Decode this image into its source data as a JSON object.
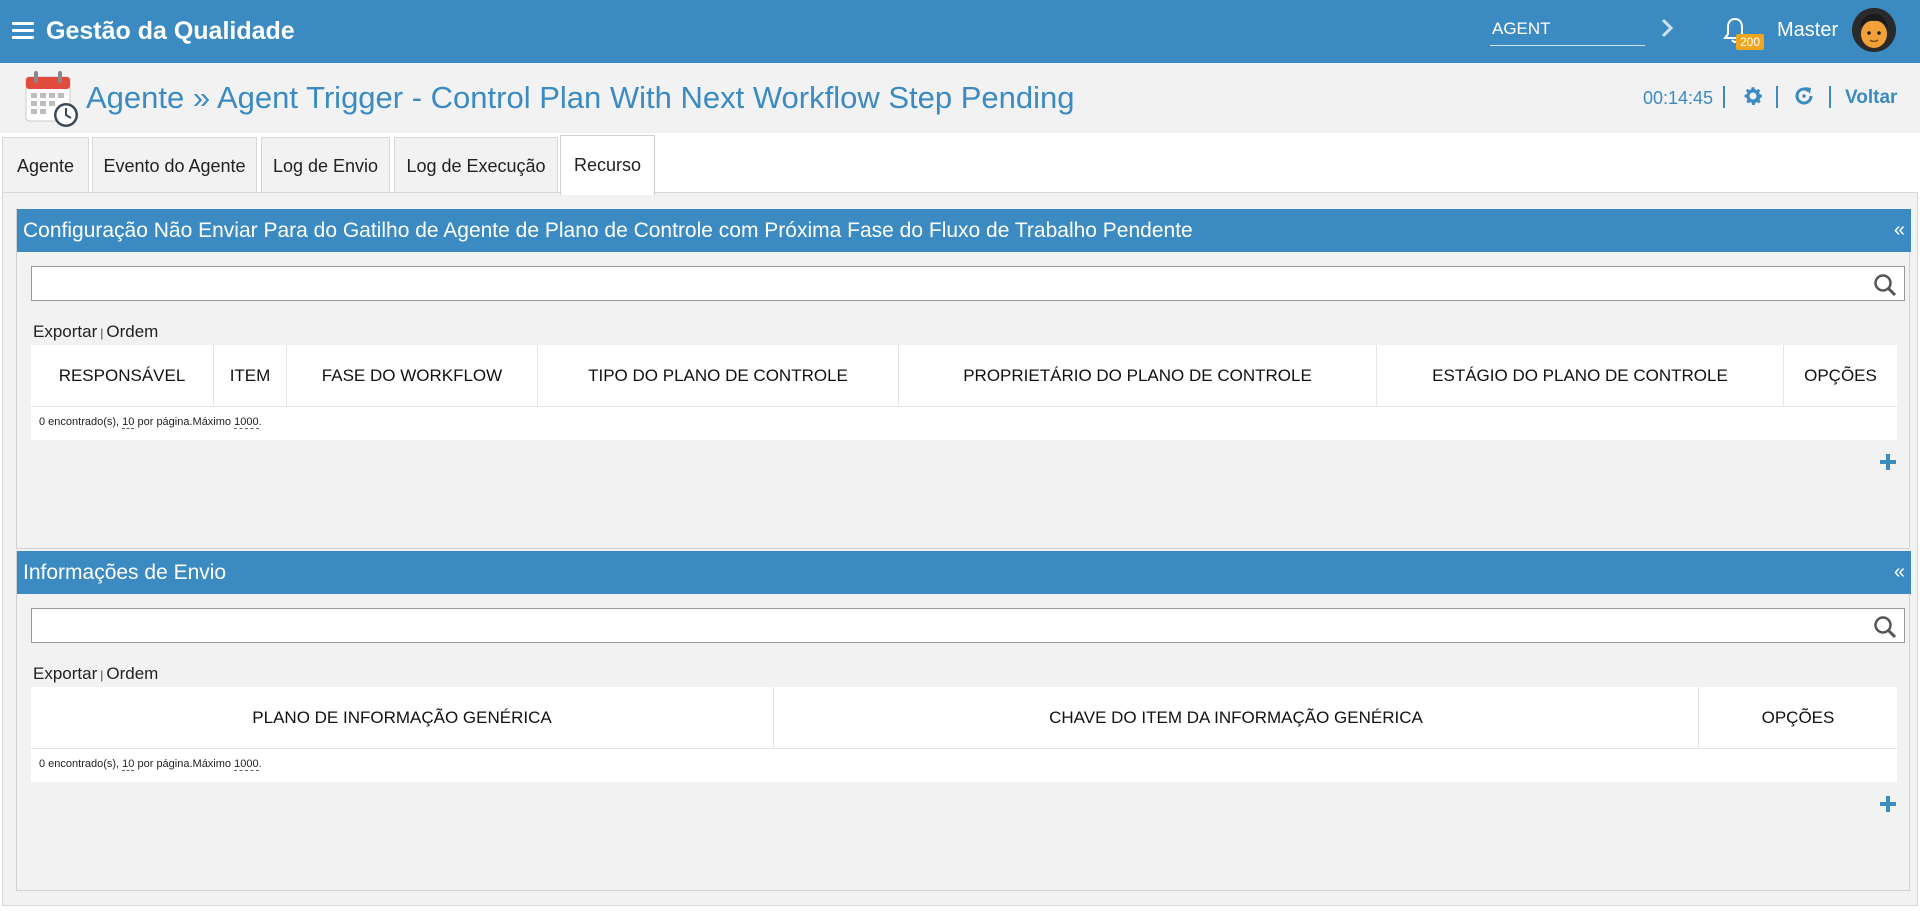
{
  "topbar": {
    "title": "Gestão da Qualidade",
    "agent_value": "AGENT",
    "notification_count": "200",
    "user_name": "Master"
  },
  "header": {
    "title": "Agente » Agent Trigger - Control Plan With Next Workflow Step Pending",
    "timer": "00:14:45",
    "back_label": "Voltar"
  },
  "tabs": [
    {
      "label": "Agente"
    },
    {
      "label": "Evento do Agente"
    },
    {
      "label": "Log de Envio"
    },
    {
      "label": "Log de Execução"
    },
    {
      "label": "Recurso"
    }
  ],
  "active_tab": "Recurso",
  "sections": [
    {
      "title": "Configuração Não Enviar Para do Gatilho de Agente de Plano de Controle com Próxima Fase do Fluxo de Trabalho Pendente",
      "collapse": "«",
      "search_value": "",
      "export_label": "Exportar",
      "order_label": "Ordem",
      "columns": [
        "RESPONSÁVEL",
        "ITEM",
        "FASE DO WORKFLOW",
        "TIPO DO PLANO DE CONTROLE",
        "PROPRIETÁRIO DO PLANO DE CONTROLE",
        "ESTÁGIO DO PLANO DE CONTROLE",
        "OPÇÕES"
      ],
      "footer": {
        "found": "0 encontrado(s),",
        "per_page": "10",
        "per_page_text": "por página.Máximo",
        "max": "1000",
        "end": "."
      }
    },
    {
      "title": "Informações de Envio",
      "collapse": "«",
      "search_value": "",
      "export_label": "Exportar",
      "order_label": "Ordem",
      "columns": [
        "PLANO DE INFORMAÇÃO GENÉRICA",
        "CHAVE DO ITEM DA INFORMAÇÃO GENÉRICA",
        "OPÇÕES"
      ],
      "footer": {
        "found": "0 encontrado(s),",
        "per_page": "10",
        "per_page_text": "por página.Máximo",
        "max": "1000",
        "end": "."
      }
    }
  ],
  "colors": {
    "primary": "#3b8bc2",
    "badge": "#f0a71f",
    "background": "#f2f2f2"
  }
}
